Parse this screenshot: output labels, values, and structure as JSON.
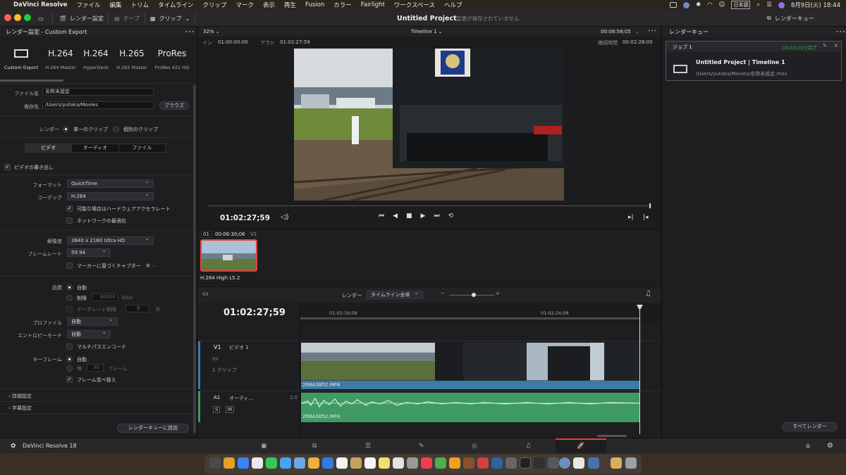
{
  "menubar": {
    "app_name": "DaVinci Resolve",
    "items": [
      "ファイル",
      "編集",
      "トリム",
      "タイムライン",
      "クリップ",
      "マーク",
      "表示",
      "再生",
      "Fusion",
      "カラー",
      "Fairlight",
      "ワークスペース",
      "ヘルプ"
    ],
    "input_method": "日本語",
    "clock": "8月9日(火)  18:44"
  },
  "toolbar": {
    "render_settings": "レンダー設定",
    "tape": "テープ",
    "clip": "クリップ",
    "project_title": "Untitled Project",
    "unsaved": "変更が保存されていません",
    "render_queue": "レンダーキュー"
  },
  "render_panel": {
    "title": "レンダー設定 - Custom Export",
    "presets": [
      {
        "big": "",
        "small": "Custom Export"
      },
      {
        "big": "H.264",
        "small": "H.264 Master"
      },
      {
        "big": "H.264",
        "small": "HyperDeck"
      },
      {
        "big": "H.265",
        "small": "H.265 Master"
      },
      {
        "big": "ProRes",
        "small": "ProRes 422 HQ"
      }
    ],
    "filename_label": "ファイル名",
    "filename": "名称未設定",
    "location_label": "保存先",
    "location": "/Users/yutaka/Movies",
    "browse": "ブラウズ",
    "render_label": "レンダー",
    "single_clip": "単一のクリップ",
    "individual_clips": "個別のクリップ",
    "tabs": [
      "ビデオ",
      "オーディオ",
      "ファイル"
    ],
    "export_video": "ビデオの書き出し",
    "format_label": "フォーマット",
    "format": "QuickTime",
    "codec_label": "コーデック",
    "codec": "H.264",
    "hw_accel": "可能な場合はハードウェアアクセラレート",
    "network_opt": "ネットワークの最適化",
    "resolution_label": "解像度",
    "resolution": "3840 x 2160 Ultra HD",
    "framerate_label": "フレームレート",
    "framerate": "59.94",
    "chapters": "マーカーに基づくチャプター",
    "quality_label": "品質",
    "quality_auto": "自動",
    "quality_limit": "制限",
    "bitrate": "80000",
    "bitrate_unit": "Kb/s",
    "data_burn": "データレート制限",
    "data_burn_val": "6",
    "data_burn_unit": "秒",
    "profile_label": "プロファイル",
    "profile": "自動",
    "entropy_label": "エントロピーモード",
    "entropy": "自動",
    "multipass": "マルチパスエンコード",
    "keyframe_label": "キーフレーム",
    "keyframe_auto": "自動",
    "keyframe_every": "毎",
    "keyframe_val": "30",
    "keyframe_unit": "フレーム",
    "frame_reorder": "フレーム並べ替え",
    "advanced": "詳細設定",
    "subtitles": "字幕設定",
    "add_queue": "レンダーキューに追加"
  },
  "viewer": {
    "zoom": "32%",
    "timeline_name": "Timeline 1",
    "duration": "00:08:58;05",
    "in_label": "イン",
    "in_tc": "01:00:00:00",
    "out_label": "アウト",
    "out_tc": "01:02:27:59",
    "total_label": "継続時間",
    "total_tc": "00:02:28:00",
    "current_tc": "01:02:27;59"
  },
  "clips": {
    "index": "01",
    "tc": "00:06:30;06",
    "track": "V1",
    "codec": "H.264 High L5.2"
  },
  "timeline": {
    "render_label": "レンダー",
    "render_mode": "タイムライン全体",
    "tc": "01:02:27;59",
    "ruler": [
      "01:02:16;08",
      "01:02:24;08"
    ],
    "v1": "V1",
    "v1_name": "ビデオ 1",
    "v1_count": "1 クリップ",
    "clip_name": "2R8A3852.MP4",
    "a1": "A1",
    "a1_name": "オーディ…",
    "a1_level": "2.0",
    "solo": "S",
    "mute": "M"
  },
  "queue": {
    "title": "レンダーキュー",
    "job": "ジョブ 1",
    "job_status": "00:03:10で完了",
    "job_title": "Untitled Project | Timeline 1",
    "job_path": "/Users/yutaka/Movies/名称未設定.mov",
    "render_all": "すべてレンダー"
  },
  "footer": {
    "app": "DaVinci Resolve 18"
  },
  "colors": {
    "accent_red": "#e0443d",
    "video_clip": "#3f79a6",
    "audio_clip": "#3f9a63",
    "done_green": "#39a84a"
  }
}
